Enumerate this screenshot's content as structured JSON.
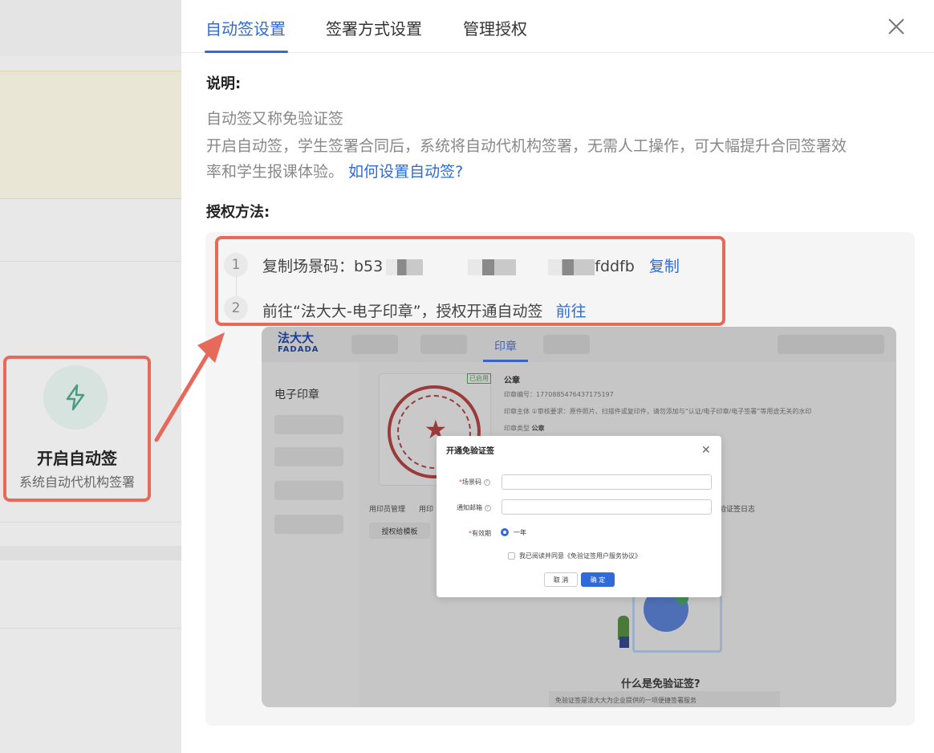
{
  "background_card": {
    "title": "开启自动签",
    "subtitle": "系统自动代机构签署",
    "icon": "lightning-icon"
  },
  "drawer": {
    "tabs": [
      {
        "label": "自动签设置",
        "active": true
      },
      {
        "label": "签署方式设置",
        "active": false
      },
      {
        "label": "管理授权",
        "active": false
      }
    ],
    "close_icon": "close-icon",
    "description_heading": "说明:",
    "description_line1": "自动签又称免验证签",
    "description_line2": "开启自动签，学生签署合同后，系统将自动代机构签署，无需人工操作，可大幅提升合同签署效",
    "description_line3": "率和学生报课体验。",
    "how_link": "如何设置自动签?",
    "method_heading": "授权方法:",
    "steps": [
      {
        "num": "1",
        "prefix": "复制场景码：b53",
        "suffix": "fddfb",
        "action": "复制"
      },
      {
        "num": "2",
        "prefix": "前往“法大大-电子印章”，授权开通自动签",
        "action": "前往"
      }
    ]
  },
  "embedded_screenshot": {
    "logo": "法大大",
    "logo_sub": "FADADA",
    "active_tab": "印章",
    "side_title": "电子印章",
    "badge": "已启用",
    "seal_name": "公章",
    "seal_no_label": "印章编号：",
    "seal_no": "1770885476437175197",
    "seal_subject_label": "印章主体",
    "seal_subject": "①审核要求：原件照片、扫描件或复印件，请勿添加与“认证/电子印章/电子签署”等用途无关的水印",
    "seal_type_label": "印章类型",
    "seal_type": "公章",
    "subtabs": [
      "用印员管理",
      "用印",
      "验证签日志"
    ],
    "template_button": "授权给模板",
    "what_title": "什么是免验证签?",
    "what_desc": "免验证签是法大大为企业提供的一项便捷签署服务",
    "dialog": {
      "title": "开通免验证签",
      "scene_label": "场景码",
      "email_label": "通知邮箱",
      "validity_label": "有效期",
      "validity_option": "一年",
      "agree_text": "我已阅读并同意《免验证签用户服务协议》",
      "cancel": "取 消",
      "ok": "确 定"
    }
  },
  "colors": {
    "accent": "#2f6bd8",
    "highlight": "#e7695a"
  }
}
